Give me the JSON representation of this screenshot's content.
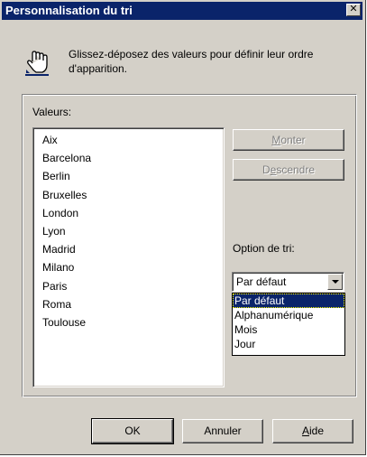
{
  "window": {
    "title": "Personnalisation du tri",
    "close_label": "✕"
  },
  "header": {
    "icon": "hand-pointer-icon",
    "instructions": "Glissez-déposez des valeurs pour définir leur ordre d'apparition."
  },
  "values": {
    "label": "Valeurs:",
    "items": [
      "Aix",
      "Barcelona",
      "Berlin",
      "Bruxelles",
      "London",
      "Lyon",
      "Madrid",
      "Milano",
      "Paris",
      "Roma",
      "Toulouse"
    ]
  },
  "buttons": {
    "up_prefix": "M",
    "up_rest": "onter",
    "down_prefix": "D",
    "down_underlined": "e",
    "down_rest": "scendre",
    "ok": "OK",
    "cancel": "Annuler",
    "help_underlined": "A",
    "help_rest": "ide"
  },
  "sort_option": {
    "label": "Option de tri:",
    "selected": "Par défaut",
    "options": [
      "Par défaut",
      "Alphanumérique",
      "Mois",
      "Jour"
    ]
  },
  "colors": {
    "face": "#d4d0c8",
    "title_bar": "#0a246a",
    "selection": "#0a246a"
  }
}
